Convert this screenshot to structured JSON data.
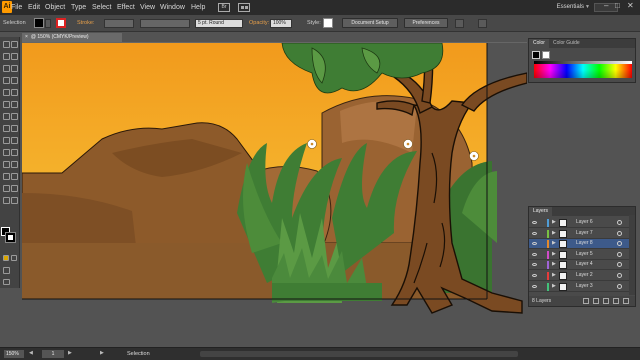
{
  "menubar": {
    "logo": "Ai",
    "items": [
      "File",
      "Edit",
      "Object",
      "Type",
      "Select",
      "Effect",
      "View",
      "Window",
      "Help"
    ],
    "bridge_label": "Br",
    "workspace": "Essentials",
    "window_controls": [
      "–",
      "□",
      "✕"
    ]
  },
  "controlbar": {
    "selection_label": "Selection",
    "stroke_label": "Stroke:",
    "brush": "5 pt. Round",
    "opacity_label": "Opacity:",
    "opacity_value": "100%",
    "style_label": "Style:",
    "document_setup": "Document Setup",
    "preferences": "Preferences"
  },
  "document": {
    "tab_title": "@ 150% (CMYK/Preview)",
    "close_glyph": "×"
  },
  "panels": {
    "color": {
      "tabs": [
        "Color",
        "Color Guide"
      ]
    },
    "layers": {
      "tab": "Layers",
      "rows": [
        {
          "name": "Layer 6",
          "color": "#4f9cd6",
          "selected": false
        },
        {
          "name": "Layer 7",
          "color": "#79c142",
          "selected": false
        },
        {
          "name": "Layer 8",
          "color": "#e58a2a",
          "selected": true
        },
        {
          "name": "Layer 5",
          "color": "#d04bc9",
          "selected": false
        },
        {
          "name": "Layer 4",
          "color": "#9f63d6",
          "selected": false
        },
        {
          "name": "Layer 2",
          "color": "#e63b3b",
          "selected": false
        },
        {
          "name": "Layer 3",
          "color": "#42c27a",
          "selected": false
        }
      ],
      "footer": "8 Layers"
    }
  },
  "statusbar": {
    "zoom": "150%",
    "page": "1",
    "status": "Selection"
  },
  "colors": {
    "sky_top": "#f29a1c",
    "sky_bottom": "#f7c12c",
    "ground": "#8a5a2b",
    "rock": "#9a6332",
    "grass": "#3f7d34",
    "tree": "#7a4a22"
  }
}
